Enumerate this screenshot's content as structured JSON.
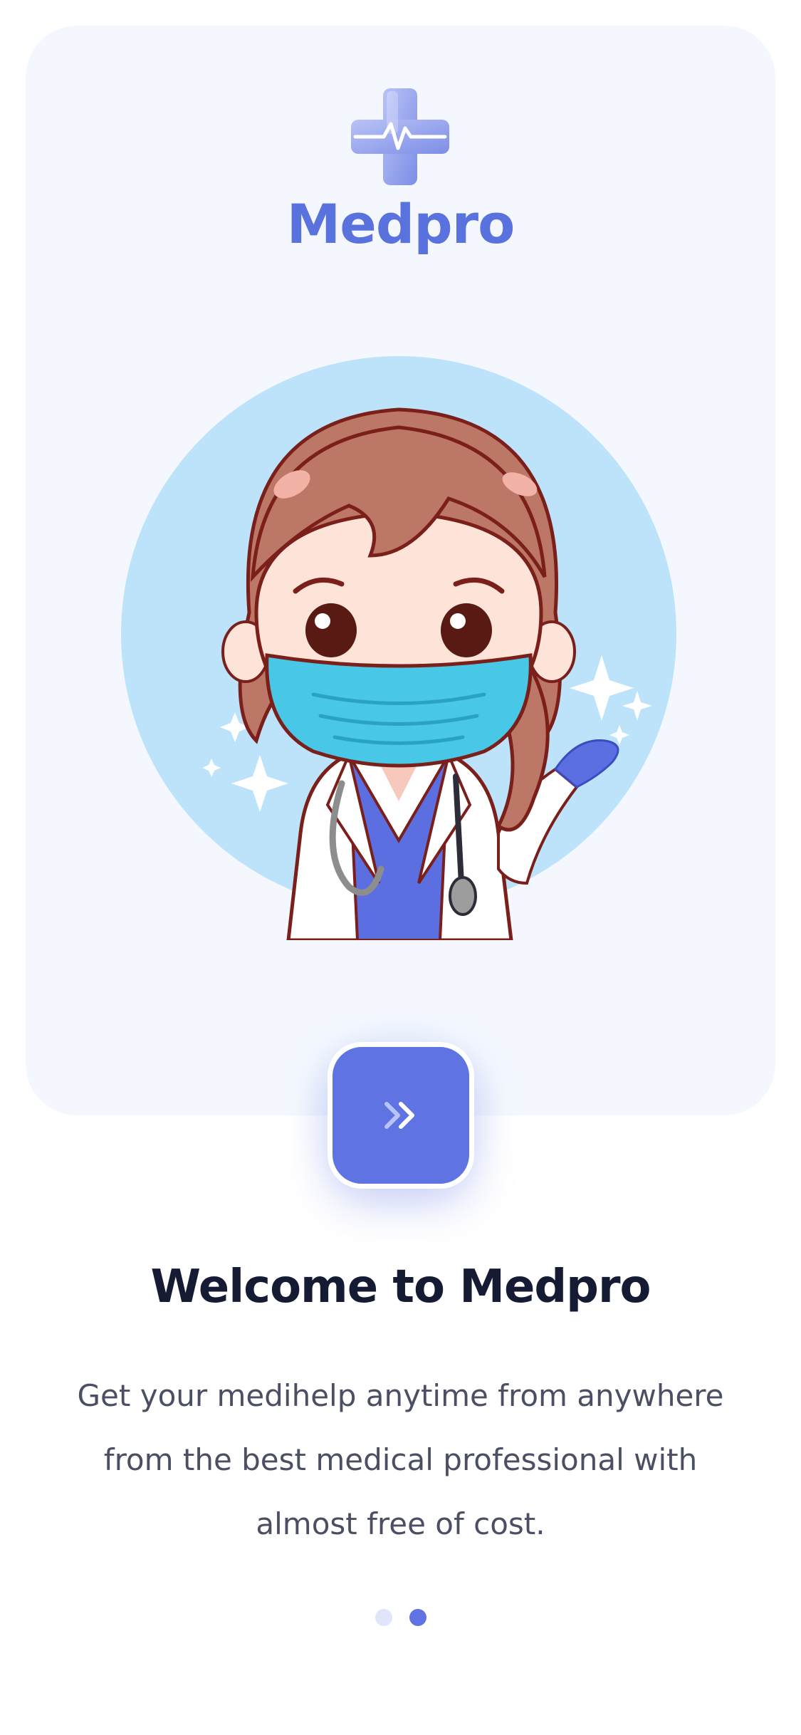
{
  "app": {
    "brand": "Medpro"
  },
  "onboarding": {
    "title": "Welcome to Medpro",
    "subtitle": "Get your medihelp anytime from anywhere from the best medical professional with almost free of cost.",
    "next_button_icon": "double-chevron-right-icon",
    "pagination": {
      "total": 2,
      "current": 2
    }
  },
  "colors": {
    "accent": "#5f73e3",
    "brand_text": "#5a72de",
    "card_background": "#f4f8fe",
    "illustration_circle": "#bde3fb",
    "headline": "#141b33",
    "body_text": "#4a4f63",
    "dot_inactive": "#e1e5fa"
  }
}
